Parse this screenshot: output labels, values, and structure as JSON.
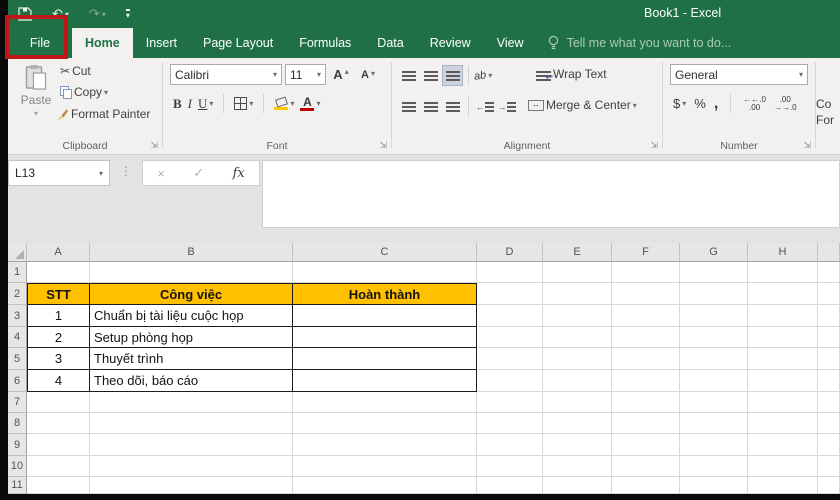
{
  "window": {
    "title": "Book1 - Excel"
  },
  "tabs": [
    {
      "label": "File"
    },
    {
      "label": "Home"
    },
    {
      "label": "Insert"
    },
    {
      "label": "Page Layout"
    },
    {
      "label": "Formulas"
    },
    {
      "label": "Data"
    },
    {
      "label": "Review"
    },
    {
      "label": "View"
    }
  ],
  "tell_me": "Tell me what you want to do...",
  "ribbon": {
    "clipboard": {
      "group": "Clipboard",
      "paste": "Paste",
      "cut": "Cut",
      "copy": "Copy",
      "format_painter": "Format Painter"
    },
    "font": {
      "group": "Font",
      "family": "Calibri",
      "size": "11",
      "bold": "B",
      "italic": "I",
      "underline": "U",
      "grow": "A",
      "shrink": "A"
    },
    "alignment": {
      "group": "Alignment",
      "orientation": "ab",
      "wrap": "Wrap Text",
      "merge": "Merge & Center"
    },
    "number": {
      "group": "Number",
      "format": "General",
      "currency": "$",
      "percent": "%",
      "comma": ",",
      "inc_top": "←.0",
      "inc_bottom": ".00",
      "dec_top": ".00",
      "dec_bottom": "→.0"
    },
    "styles_clipped": {
      "line1": "Co",
      "line2": "For"
    }
  },
  "formula_bar": {
    "name_box": "L13",
    "cancel": "×",
    "enter": "✓",
    "fx": "fx"
  },
  "glyphs": {
    "dropdown": "▾",
    "up": "▴",
    "undo": "↶",
    "redo": "↷",
    "launcher": "⇲",
    "dots": "⋮",
    "scissors": "✂",
    "wrap_arrow": "↩",
    "outdent": "←",
    "indent": "→",
    "merge_arrow": "↔"
  },
  "sheet": {
    "columns": [
      "A",
      "B",
      "C",
      "D",
      "E",
      "F",
      "G",
      "H"
    ],
    "rows": [
      "1",
      "2",
      "3",
      "4",
      "5",
      "6",
      "7",
      "8",
      "9",
      "10",
      "11"
    ],
    "table": {
      "header_row": 2,
      "headers": [
        "STT",
        "Công việc",
        "Hoàn thành"
      ],
      "rows": [
        [
          "1",
          "Chuẩn bị tài liệu cuộc họp",
          ""
        ],
        [
          "2",
          "Setup phòng họp",
          ""
        ],
        [
          "3",
          "Thuyết trình",
          ""
        ],
        [
          "4",
          "Theo dõi, báo cáo",
          ""
        ]
      ]
    }
  },
  "colors": {
    "green": "#1f7145",
    "ribbon_bg": "#f2f1ef",
    "header_yellow": "#ffc000",
    "annotation_red": "#c01717",
    "accent_blue": "#2456a4"
  }
}
